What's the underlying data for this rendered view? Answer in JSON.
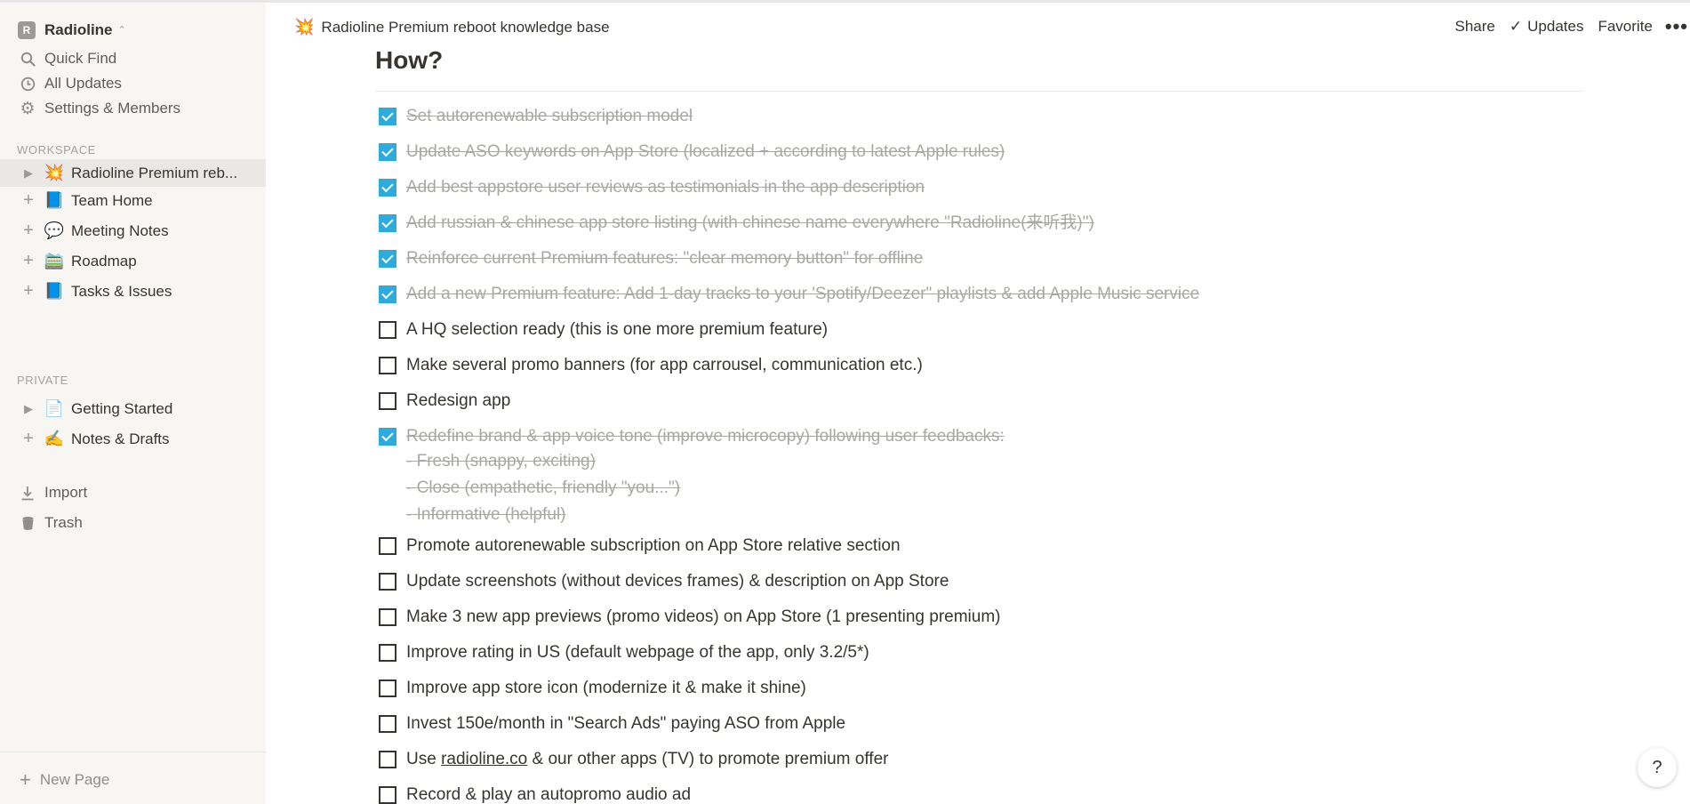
{
  "sidebar": {
    "workspace_initial": "R",
    "workspace_name": "Radioline",
    "nav": [
      {
        "label": "Quick Find",
        "icon": "search-icon"
      },
      {
        "label": "All Updates",
        "icon": "clock-icon"
      },
      {
        "label": "Settings & Members",
        "icon": "gear-icon"
      }
    ],
    "workspace_label": "WORKSPACE",
    "workspace_pages": [
      {
        "label": "Radioline Premium reb...",
        "emoji": "💥",
        "lead": "▶",
        "active": true
      },
      {
        "label": "Team Home",
        "emoji": "📘",
        "lead": "+"
      },
      {
        "label": "Meeting Notes",
        "emoji": "💬",
        "lead": "+"
      },
      {
        "label": "Roadmap",
        "emoji": "🚞",
        "lead": "+"
      },
      {
        "label": "Tasks & Issues",
        "emoji": "📘",
        "lead": "+"
      }
    ],
    "private_label": "PRIVATE",
    "private_pages": [
      {
        "label": "Getting Started",
        "emoji": "📄",
        "lead": "▶"
      },
      {
        "label": "Notes & Drafts",
        "emoji": "✍️",
        "lead": "+"
      }
    ],
    "import_label": "Import",
    "trash_label": "Trash",
    "new_page_label": "New Page"
  },
  "topbar": {
    "breadcrumb_emoji": "💥",
    "breadcrumb": "Radioline Premium reboot knowledge base",
    "share": "Share",
    "updates": "Updates",
    "favorite": "Favorite",
    "more": "•••"
  },
  "content": {
    "heading": "How?",
    "todos": [
      {
        "text": "Set autorenewable subscription model",
        "checked": true
      },
      {
        "text": "Update ASO keywords on App Store (localized + according to latest Apple rules)",
        "checked": true
      },
      {
        "text": "Add best appstore user reviews as testimonials in the app description",
        "checked": true
      },
      {
        "text": "Add russian & chinese app store listing (with chinese name everywhere \"Radioline(来听我)\")",
        "checked": true
      },
      {
        "text": "Reinforce current Premium features: \"clear memory button\" for offline",
        "checked": true
      },
      {
        "text": "Add a new Premium feature: Add 1-day tracks to your 'Spotify/Deezer\" playlists & add Apple Music service",
        "checked": true
      },
      {
        "text": "A HQ selection ready (this is one more premium feature)",
        "checked": false
      },
      {
        "text": "Make several promo banners (for app carrousel, communication etc.)",
        "checked": false
      },
      {
        "text": "Redesign app",
        "checked": false
      },
      {
        "text": "Redefine brand & app voice tone (improve microcopy) following user feedbacks:",
        "checked": true,
        "sub": [
          "- Fresh (snappy, exciting)",
          "- Close (empathetic, friendly \"you...\")",
          "- Informative (helpful)"
        ]
      },
      {
        "text": "Promote autorenewable subscription on App Store relative section",
        "checked": false
      },
      {
        "text": "Update screenshots (without devices frames) & description on App Store",
        "checked": false
      },
      {
        "text": "Make 3 new app previews (promo videos) on App Store (1 presenting premium)",
        "checked": false
      },
      {
        "text": "Improve rating in US (default webpage of the app, only 3.2/5*)",
        "checked": false
      },
      {
        "text": "Improve app store icon (modernize it & make it shine)",
        "checked": false
      },
      {
        "text": "Invest 150e/month in \"Search Ads\" paying ASO from Apple",
        "checked": false
      },
      {
        "text_pre": "Use ",
        "link": "radioline.co",
        "text_post": " & our other apps (TV) to promote premium offer",
        "checked": false
      },
      {
        "text": "Record & play an autopromo audio ad",
        "checked": false
      }
    ]
  },
  "help_label": "?"
}
